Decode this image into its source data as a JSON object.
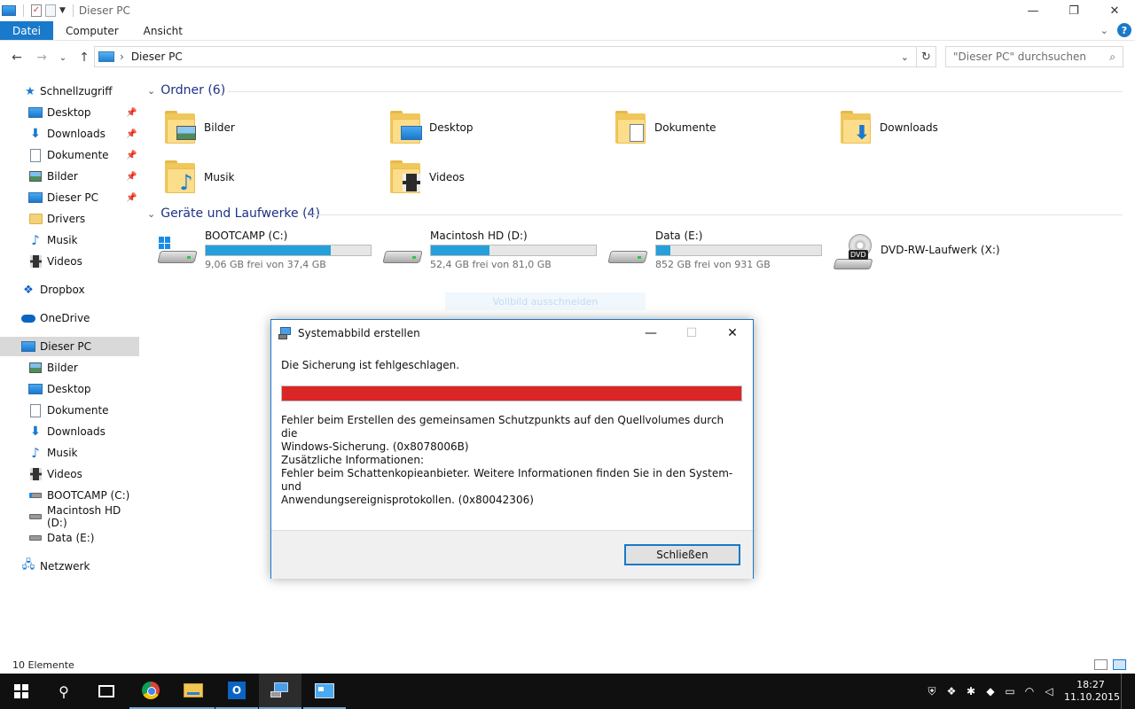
{
  "window": {
    "title": "Dieser PC",
    "controls": {
      "minimize": "—",
      "maximize": "❐",
      "close": "✕"
    }
  },
  "ribbon": {
    "tabs": [
      {
        "label": "Datei",
        "active": true
      },
      {
        "label": "Computer",
        "active": false
      },
      {
        "label": "Ansicht",
        "active": false
      }
    ],
    "help_label": "?"
  },
  "address": {
    "path": "Dieser PC",
    "search_placeholder": "\"Dieser PC\" durchsuchen"
  },
  "sidebar": {
    "items": [
      {
        "label": "Schnellzugriff",
        "icon": "star-icon"
      },
      {
        "label": "Desktop",
        "icon": "desktop-icon",
        "pinned": true
      },
      {
        "label": "Downloads",
        "icon": "download-arrow-icon",
        "pinned": true
      },
      {
        "label": "Dokumente",
        "icon": "document-icon",
        "pinned": true
      },
      {
        "label": "Bilder",
        "icon": "picture-icon",
        "pinned": true
      },
      {
        "label": "Dieser PC",
        "icon": "computer-icon",
        "pinned": true
      },
      {
        "label": "Drivers",
        "icon": "folder-icon"
      },
      {
        "label": "Musik",
        "icon": "music-note-icon"
      },
      {
        "label": "Videos",
        "icon": "film-icon"
      },
      {
        "label": "Dropbox",
        "icon": "dropbox-icon"
      },
      {
        "label": "OneDrive",
        "icon": "cloud-icon"
      },
      {
        "label": "Dieser PC",
        "icon": "computer-icon",
        "selected": true
      },
      {
        "label": "Bilder",
        "icon": "picture-icon"
      },
      {
        "label": "Desktop",
        "icon": "desktop-icon"
      },
      {
        "label": "Dokumente",
        "icon": "document-icon"
      },
      {
        "label": "Downloads",
        "icon": "download-arrow-icon"
      },
      {
        "label": "Musik",
        "icon": "music-note-icon"
      },
      {
        "label": "Videos",
        "icon": "film-icon"
      },
      {
        "label": "BOOTCAMP (C:)",
        "icon": "windows-drive-icon"
      },
      {
        "label": "Macintosh HD (D:)",
        "icon": "drive-icon"
      },
      {
        "label": "Data (E:)",
        "icon": "drive-icon"
      },
      {
        "label": "Netzwerk",
        "icon": "network-icon"
      }
    ]
  },
  "content": {
    "folders_header": "Ordner (6)",
    "folders": [
      {
        "name": "Bilder",
        "icon": "pictures-folder-icon"
      },
      {
        "name": "Desktop",
        "icon": "desktop-folder-icon"
      },
      {
        "name": "Dokumente",
        "icon": "documents-folder-icon"
      },
      {
        "name": "Downloads",
        "icon": "downloads-folder-icon"
      },
      {
        "name": "Musik",
        "icon": "music-folder-icon"
      },
      {
        "name": "Videos",
        "icon": "videos-folder-icon"
      }
    ],
    "drives_header": "Geräte und Laufwerke (4)",
    "drives": [
      {
        "name": "BOOTCAMP (C:)",
        "free": "9,06 GB frei von 37,4 GB",
        "used_fraction": 0.758
      },
      {
        "name": "Macintosh HD (D:)",
        "free": "52,4 GB frei von 81,0 GB",
        "used_fraction": 0.353
      },
      {
        "name": "Data (E:)",
        "free": "852 GB frei von 931 GB",
        "used_fraction": 0.085
      }
    ],
    "dvd": {
      "name": "DVD-RW-Laufwerk (X:)",
      "badge": "DVD"
    },
    "ghost_label": "Vollbild ausschneiden"
  },
  "statusbar": {
    "count": "10 Elemente"
  },
  "dialog": {
    "title": "Systemabbild erstellen",
    "message": "Die Sicherung ist fehlgeschlagen.",
    "progress_fraction": 1.0,
    "progress_color": "#da2626",
    "error_line1": "Fehler beim Erstellen des gemeinsamen Schutzpunkts auf den Quellvolumes durch die",
    "error_line2": "Windows-Sicherung. (0x8078006B)",
    "info_title": "Zusätzliche Informationen:",
    "info_line1": "Fehler beim Schattenkopieanbieter. Weitere Informationen finden Sie in den System- und",
    "info_line2": "Anwendungsereignisprotokollen. (0x80042306)",
    "close_button": "Schließen"
  },
  "taskbar": {
    "time": "18:27",
    "date": "11.10.2015",
    "outlook_letter": "O"
  },
  "colors": {
    "accent": "#1979ca",
    "drive_bar": "#26a0da",
    "header_text": "#1e3287"
  }
}
